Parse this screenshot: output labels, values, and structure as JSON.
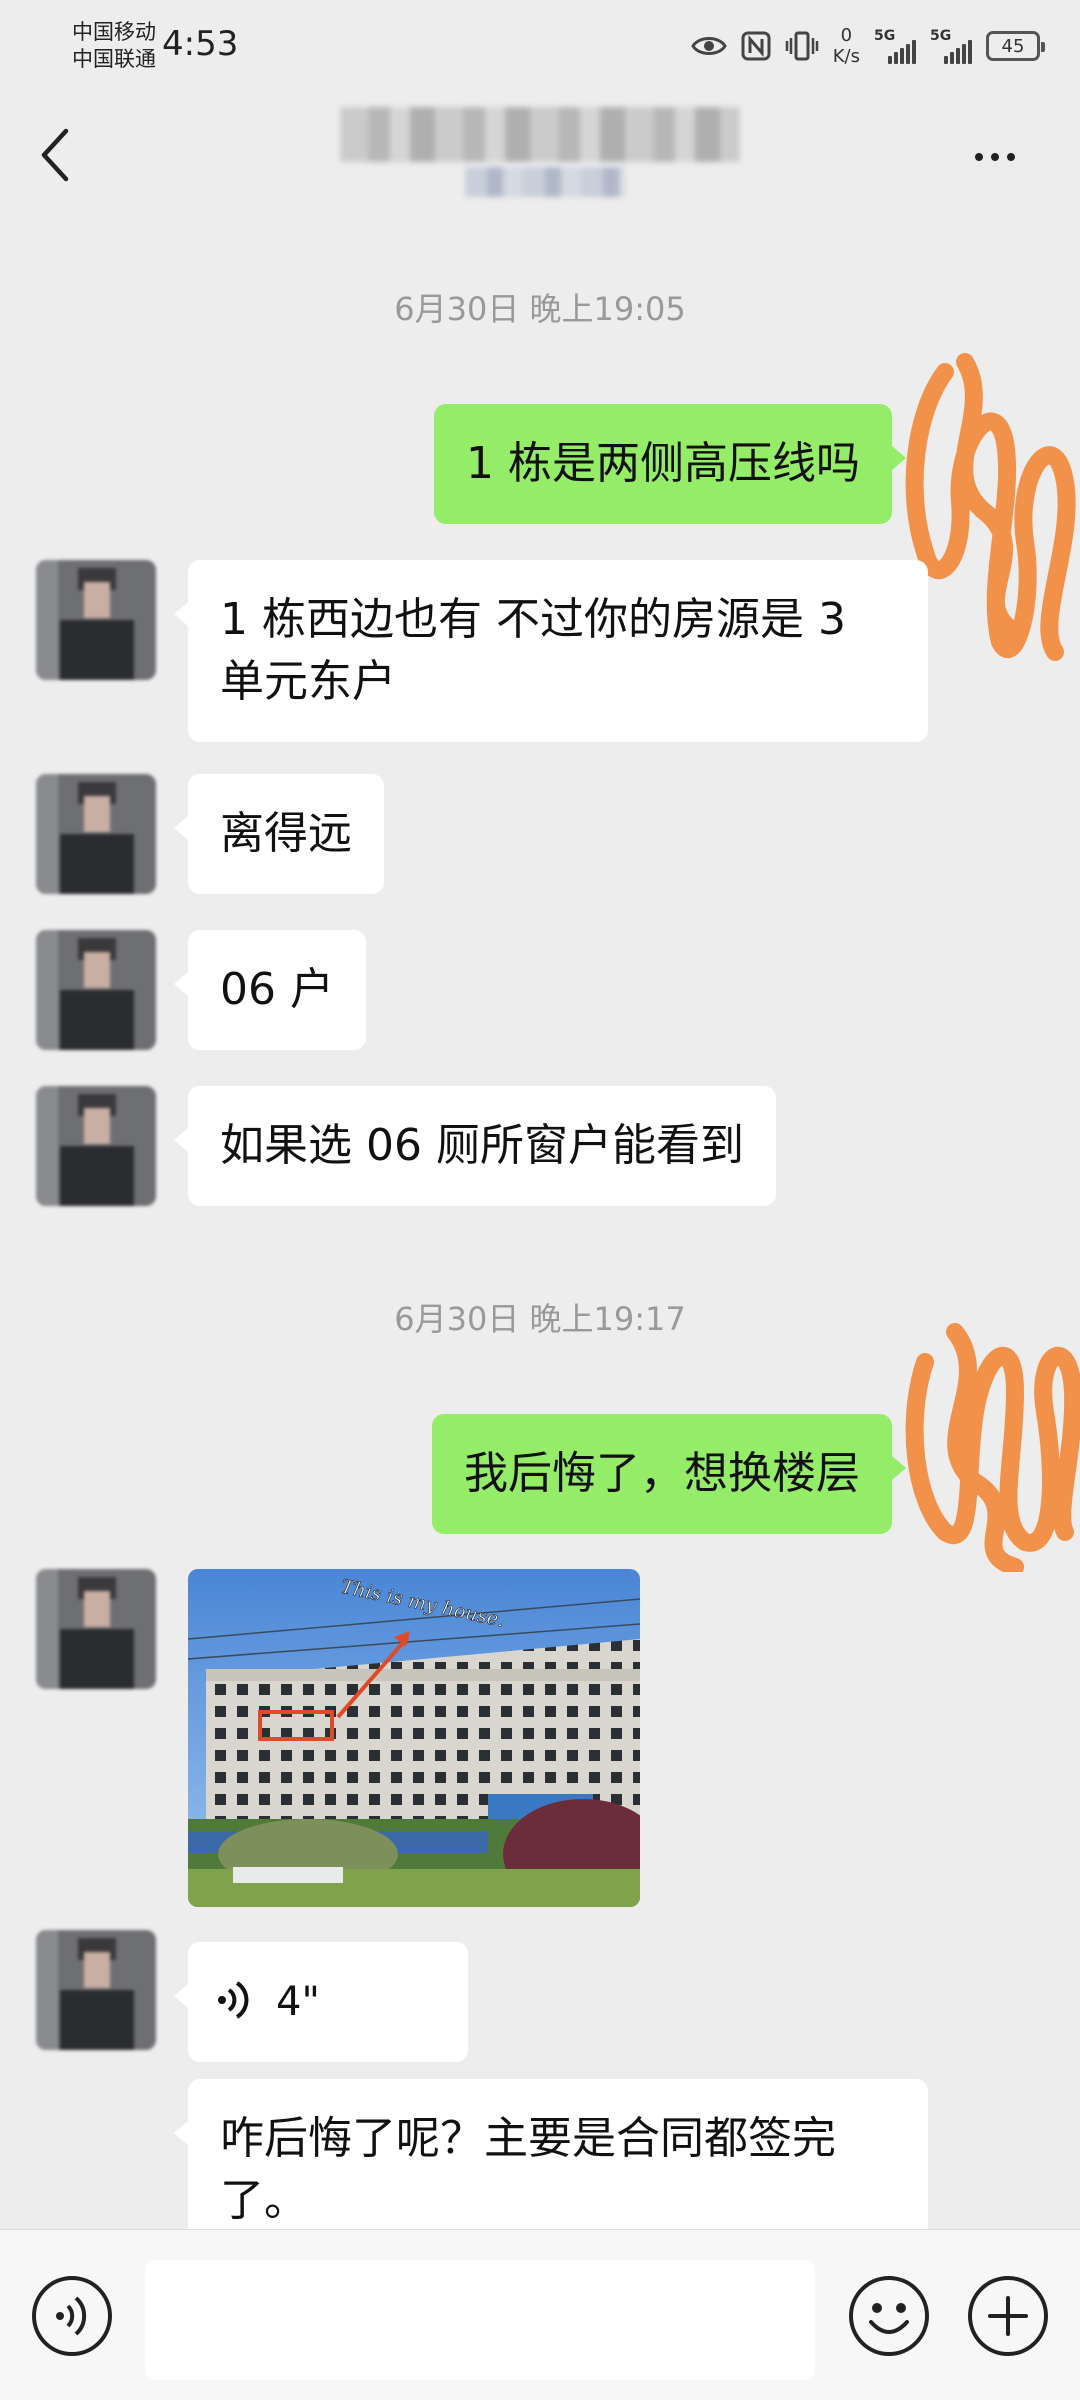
{
  "status_bar": {
    "carrier_1": "中国移动",
    "carrier_2": "中国联通",
    "time": "4:53",
    "net_speed_value": "0",
    "net_speed_unit": "K/s",
    "signal_tag_1": "5G",
    "signal_tag_2": "5G",
    "battery": "45",
    "icons": [
      "eye-icon",
      "nfc-icon",
      "vibrate-icon"
    ]
  },
  "header": {
    "back_icon": "chevron-left-icon",
    "more_icon": "more-dots-icon"
  },
  "chat": {
    "timestamps": [
      "6月30日 晚上19:05",
      "6月30日 晚上19:17"
    ],
    "messages": [
      {
        "side": "right",
        "text": "1 栋是两侧高压线吗"
      },
      {
        "side": "left",
        "text": "1 栋西边也有  不过你的房源是 3 单元东户"
      },
      {
        "side": "left",
        "text": "离得远"
      },
      {
        "side": "left",
        "text": "06 户"
      },
      {
        "side": "left",
        "text": "如果选 06 厕所窗户能看到"
      },
      {
        "side": "right",
        "text": "我后悔了，想换楼层"
      },
      {
        "side": "left",
        "type": "image",
        "caption": "This is my house."
      },
      {
        "side": "left",
        "type": "voice",
        "duration": "4\""
      },
      {
        "side": "left",
        "text": "咋后悔了呢？主要是合同都签完了。"
      }
    ]
  },
  "input_bar": {
    "voice_icon": "voice-mode-icon",
    "input_value": "",
    "emoji_icon": "emoji-icon",
    "plus_icon": "plus-icon"
  },
  "colors": {
    "background": "#ededed",
    "outgoing_bubble": "#95ec69",
    "incoming_bubble": "#ffffff",
    "timestamp": "#999999",
    "scribble": "#f2924a"
  }
}
